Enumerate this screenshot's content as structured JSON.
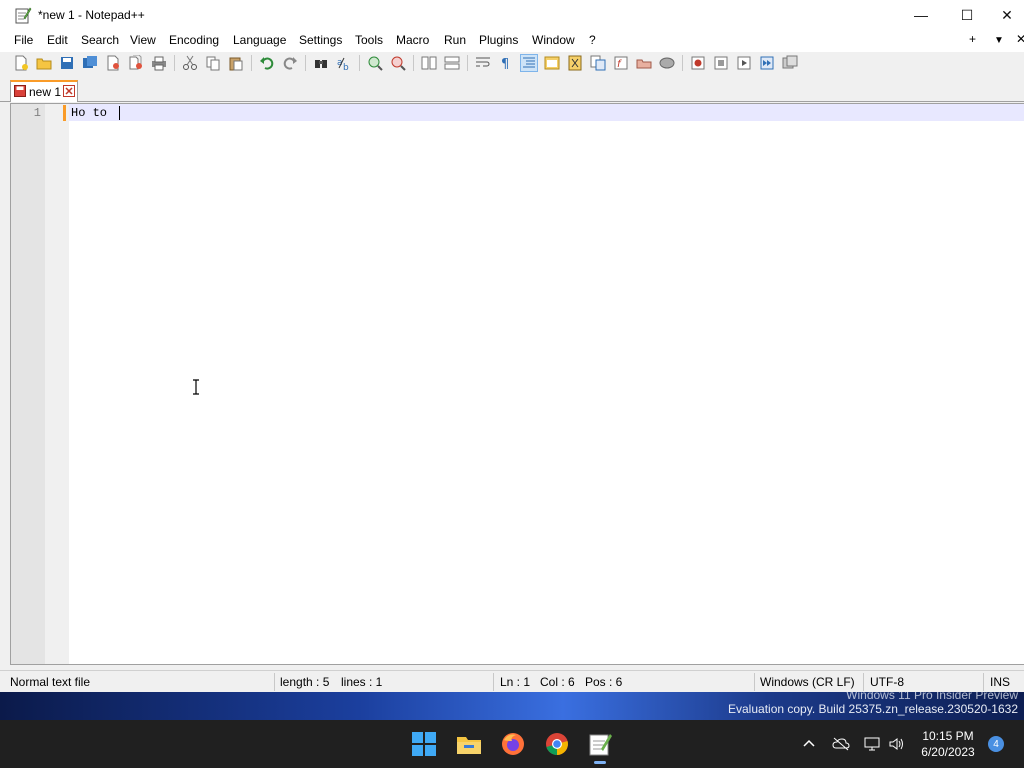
{
  "window": {
    "title": "*new 1 - Notepad++",
    "controls": {
      "minimize": "—",
      "maximize": "☐",
      "close": "✕"
    }
  },
  "menu": {
    "items": [
      "File",
      "Edit",
      "Search",
      "View",
      "Encoding",
      "Language",
      "Settings",
      "Tools",
      "Macro",
      "Run",
      "Plugins",
      "Window",
      "?"
    ],
    "right": {
      "add": "+",
      "dropdown": "▼",
      "close": "✕"
    }
  },
  "toolbar": {
    "icons": [
      "new-file-icon",
      "open-file-icon",
      "save-icon",
      "save-all-icon",
      "close-icon",
      "close-all-icon",
      "print-icon",
      "cut-icon",
      "copy-icon",
      "paste-icon",
      "undo-icon",
      "redo-icon",
      "find-icon",
      "replace-icon",
      "zoom-in-icon",
      "zoom-out-icon",
      "sync-vertical-icon",
      "sync-horizontal-icon",
      "word-wrap-icon",
      "show-all-chars-icon",
      "indent-guide-icon",
      "udl-icon",
      "doc-map-icon",
      "function-list-icon",
      "folder-workspace-icon",
      "monitoring-icon",
      "macro-record-icon",
      "macro-stop-icon",
      "macro-play-icon",
      "macro-run-multiple-icon",
      "macro-save-icon"
    ]
  },
  "tabs": [
    {
      "label": "new 1",
      "modified": true
    }
  ],
  "editor": {
    "lines": [
      {
        "number": "1",
        "text": "Ho to"
      }
    ]
  },
  "status": {
    "file_type": "Normal text file",
    "length": "length : 5",
    "lines": "lines : 1",
    "ln": "Ln : 1",
    "col": "Col : 6",
    "pos": "Pos : 6",
    "eol": "Windows (CR LF)",
    "encoding": "UTF-8",
    "mode": "INS"
  },
  "desktop": {
    "watermark_line1": "Windows 11 Pro Insider Preview",
    "watermark_line2": "Evaluation copy. Build 25375.zn_release.230520-1632"
  },
  "taskbar": {
    "apps": [
      "start-icon",
      "file-explorer-icon",
      "firefox-icon",
      "chrome-icon",
      "notepad-plus-plus-icon"
    ],
    "active_app": "notepad-plus-plus-icon",
    "tray_icons": [
      "chevron-up-icon",
      "onedrive-icon",
      "network-icon",
      "volume-icon"
    ],
    "time": "10:15 PM",
    "date": "6/20/2023",
    "notification_count": "4"
  },
  "colors": {
    "tab_accent": "#fa9b28",
    "current_line": "#e8e8ff",
    "taskbar": "#202020"
  }
}
